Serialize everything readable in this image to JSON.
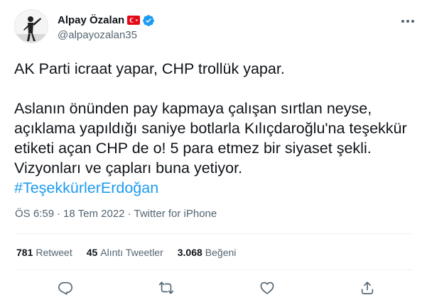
{
  "author": {
    "name": "Alpay Özalan",
    "handle": "@alpayozalan35",
    "flag_icon": "turkey-flag-icon",
    "verified_icon": "verified-badge-icon",
    "verified_color": "#1d9bf0",
    "flag_color": "#e30a17"
  },
  "tweet": {
    "line1": "AK Parti icraat yapar, CHP trollük yapar.",
    "body": "Aslanın önünden pay kapmaya çalışan sırtlan neyse, açıklama yapıldığı saniye botlarla Kılıçdaroğlu'na teşekkür etiketi açan CHP de o! 5 para etmez bir siyaset şekli. Vizyonları ve çapları buna yetiyor.",
    "hashtag": "#TeşekkürlerErdoğan",
    "hashtag_color": "#1d9bf0"
  },
  "meta": {
    "time": "ÖS 6:59",
    "separator": "·",
    "date": "18 Tem 2022",
    "source": "Twitter for iPhone"
  },
  "stats": [
    {
      "count": "781",
      "label": "Retweet"
    },
    {
      "count": "45",
      "label": "Alıntı Tweetler"
    },
    {
      "count": "3.068",
      "label": "Beğeni"
    }
  ],
  "actions": {
    "reply_icon": "reply-icon",
    "retweet_icon": "retweet-icon",
    "like_icon": "heart-icon",
    "share_icon": "share-icon"
  },
  "more_icon": "more-options-icon"
}
